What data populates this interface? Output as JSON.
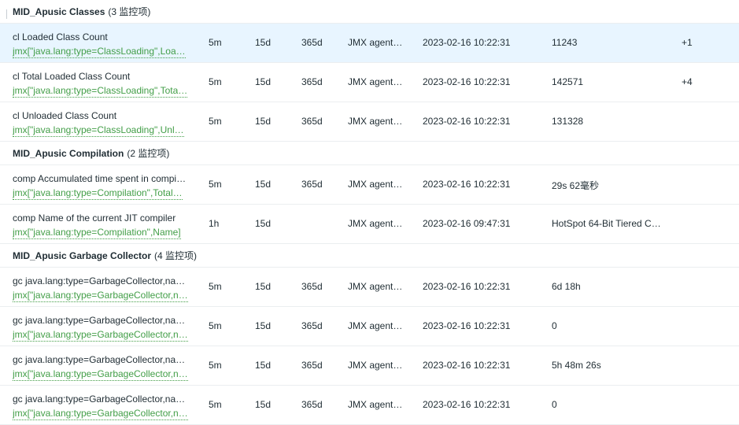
{
  "groups": [
    {
      "name": "MID_Apusic Classes",
      "count": "(3 监控项)",
      "items": [
        {
          "name": "cl Loaded Class Count",
          "key": "jmx[\"java.lang:type=ClassLoading\",Loa…",
          "interval": "5m",
          "history": "15d",
          "trends": "365d",
          "type": "JMX agent…",
          "last_check": "2023-02-16 10:22:31",
          "last_value": "11243",
          "change": "+1",
          "selected": true
        },
        {
          "name": "cl Total Loaded Class Count",
          "key": "jmx[\"java.lang:type=ClassLoading\",Tota…",
          "interval": "5m",
          "history": "15d",
          "trends": "365d",
          "type": "JMX agent…",
          "last_check": "2023-02-16 10:22:31",
          "last_value": "142571",
          "change": "+4"
        },
        {
          "name": "cl Unloaded Class Count",
          "key": "jmx[\"java.lang:type=ClassLoading\",Unl…",
          "interval": "5m",
          "history": "15d",
          "trends": "365d",
          "type": "JMX agent…",
          "last_check": "2023-02-16 10:22:31",
          "last_value": "131328",
          "change": ""
        }
      ]
    },
    {
      "name": "MID_Apusic Compilation",
      "count": "(2 监控项)",
      "items": [
        {
          "name": "comp Accumulated time spent in compi…",
          "key": "jmx[\"java.lang:type=Compilation\",Total…",
          "interval": "5m",
          "history": "15d",
          "trends": "365d",
          "type": "JMX agent…",
          "last_check": "2023-02-16 10:22:31",
          "last_value": "29s 62毫秒",
          "change": ""
        },
        {
          "name": "comp Name of the current JIT compiler",
          "key": "jmx[\"java.lang:type=Compilation\",Name]",
          "interval": "1h",
          "history": "15d",
          "trends": "",
          "type": "JMX agent…",
          "last_check": "2023-02-16 09:47:31",
          "last_value": "HotSpot 64-Bit Tiered C…",
          "change": ""
        }
      ]
    },
    {
      "name": "MID_Apusic Garbage Collector",
      "count": "(4 监控项)",
      "items": [
        {
          "name": "gc java.lang:type=GarbageCollector,na…",
          "key": "jmx[\"java.lang:type=GarbageCollector,n…",
          "interval": "5m",
          "history": "15d",
          "trends": "365d",
          "type": "JMX agent…",
          "last_check": "2023-02-16 10:22:31",
          "last_value": "6d 18h",
          "change": ""
        },
        {
          "name": "gc java.lang:type=GarbageCollector,na…",
          "key": "jmx[\"java.lang:type=GarbageCollector,n…",
          "interval": "5m",
          "history": "15d",
          "trends": "365d",
          "type": "JMX agent…",
          "last_check": "2023-02-16 10:22:31",
          "last_value": "0",
          "change": ""
        },
        {
          "name": "gc java.lang:type=GarbageCollector,na…",
          "key": "jmx[\"java.lang:type=GarbageCollector,n…",
          "interval": "5m",
          "history": "15d",
          "trends": "365d",
          "type": "JMX agent…",
          "last_check": "2023-02-16 10:22:31",
          "last_value": "5h 48m 26s",
          "change": ""
        },
        {
          "name": "gc java.lang:type=GarbageCollector,na…",
          "key": "jmx[\"java.lang:type=GarbageCollector,n…",
          "interval": "5m",
          "history": "15d",
          "trends": "365d",
          "type": "JMX agent…",
          "last_check": "2023-02-16 10:22:31",
          "last_value": "0",
          "change": ""
        }
      ]
    }
  ]
}
